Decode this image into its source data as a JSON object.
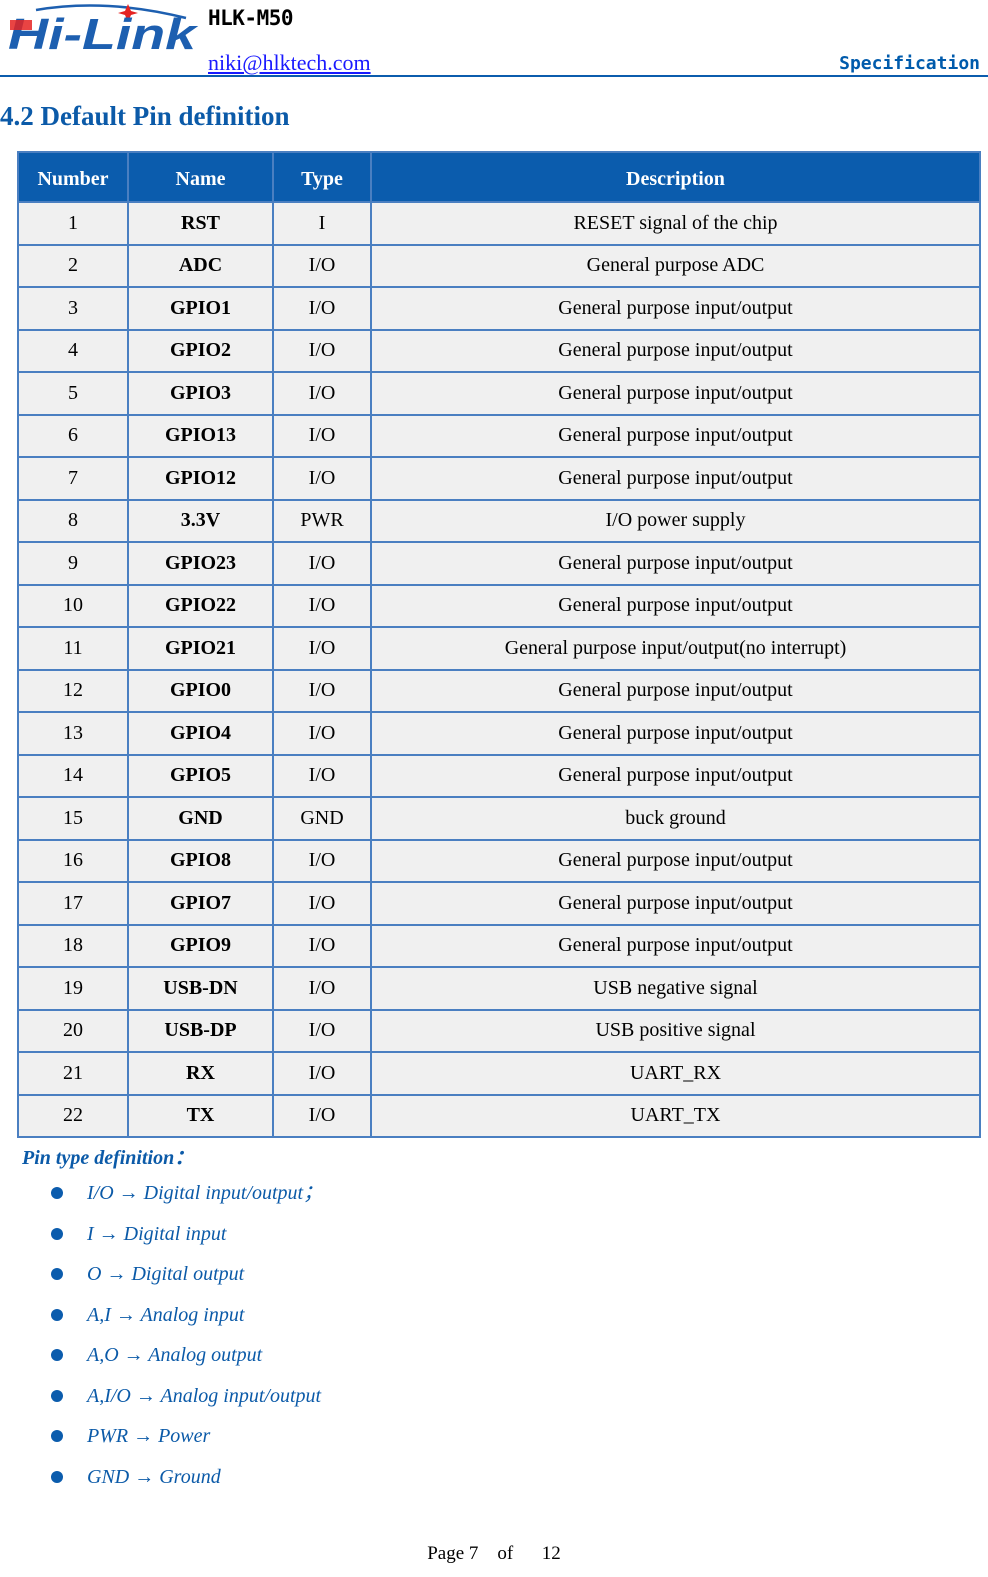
{
  "header": {
    "logo_text": "Hi-Link",
    "model": "HLK-M50",
    "email": "niki@hlktech.com",
    "doc_type": "Specification",
    "colors": {
      "brand_blue": "#1d5fb0",
      "brand_red": "#e52322",
      "accent": "#0b5cad"
    }
  },
  "section": {
    "title": "4.2 Default Pin definition"
  },
  "table": {
    "headers": [
      "Number",
      "Name",
      "Type",
      "Description"
    ],
    "rows": [
      {
        "number": "1",
        "name": "RST",
        "type": "I",
        "description": "RESET signal of the chip"
      },
      {
        "number": "2",
        "name": "ADC",
        "type": "I/O",
        "description": "General purpose ADC"
      },
      {
        "number": "3",
        "name": "GPIO1",
        "type": "I/O",
        "description": "General purpose input/output"
      },
      {
        "number": "4",
        "name": "GPIO2",
        "type": "I/O",
        "description": "General purpose input/output"
      },
      {
        "number": "5",
        "name": "GPIO3",
        "type": "I/O",
        "description": "General purpose input/output"
      },
      {
        "number": "6",
        "name": "GPIO13",
        "type": "I/O",
        "description": "General purpose input/output"
      },
      {
        "number": "7",
        "name": "GPIO12",
        "type": "I/O",
        "description": "General purpose input/output"
      },
      {
        "number": "8",
        "name": "3.3V",
        "type": "PWR",
        "description": "I/O power supply"
      },
      {
        "number": "9",
        "name": "GPIO23",
        "type": "I/O",
        "description": "General purpose input/output"
      },
      {
        "number": "10",
        "name": "GPIO22",
        "type": "I/O",
        "description": "General purpose input/output"
      },
      {
        "number": "11",
        "name": "GPIO21",
        "type": "I/O",
        "description": "General purpose input/output(no interrupt)"
      },
      {
        "number": "12",
        "name": "GPIO0",
        "type": "I/O",
        "description": "General purpose input/output"
      },
      {
        "number": "13",
        "name": "GPIO4",
        "type": "I/O",
        "description": "General purpose input/output"
      },
      {
        "number": "14",
        "name": "GPIO5",
        "type": "I/O",
        "description": "General purpose input/output"
      },
      {
        "number": "15",
        "name": "GND",
        "type": "GND",
        "description": "buck ground"
      },
      {
        "number": "16",
        "name": "GPIO8",
        "type": "I/O",
        "description": "General purpose input/output"
      },
      {
        "number": "17",
        "name": "GPIO7",
        "type": "I/O",
        "description": "General purpose input/output"
      },
      {
        "number": "18",
        "name": "GPIO9",
        "type": "I/O",
        "description": "General purpose input/output"
      },
      {
        "number": "19",
        "name": "USB-DN",
        "type": "I/O",
        "description": "USB negative signal"
      },
      {
        "number": "20",
        "name": "USB-DP",
        "type": "I/O",
        "description": "USB positive signal"
      },
      {
        "number": "21",
        "name": "RX",
        "type": "I/O",
        "description": "UART_RX"
      },
      {
        "number": "22",
        "name": "TX",
        "type": "I/O",
        "description": "UART_TX"
      }
    ]
  },
  "legend": {
    "title": "Pin type definition：",
    "items": [
      "I/O → Digital input/output；",
      "I → Digital input",
      "O → Digital output",
      "A,I → Analog input",
      "A,O → Analog output",
      "A,I/O → Analog input/output",
      "PWR → Power",
      "GND → Ground"
    ]
  },
  "footer": {
    "page_label": "Page 7",
    "of_label": "of",
    "total_pages": "12"
  }
}
